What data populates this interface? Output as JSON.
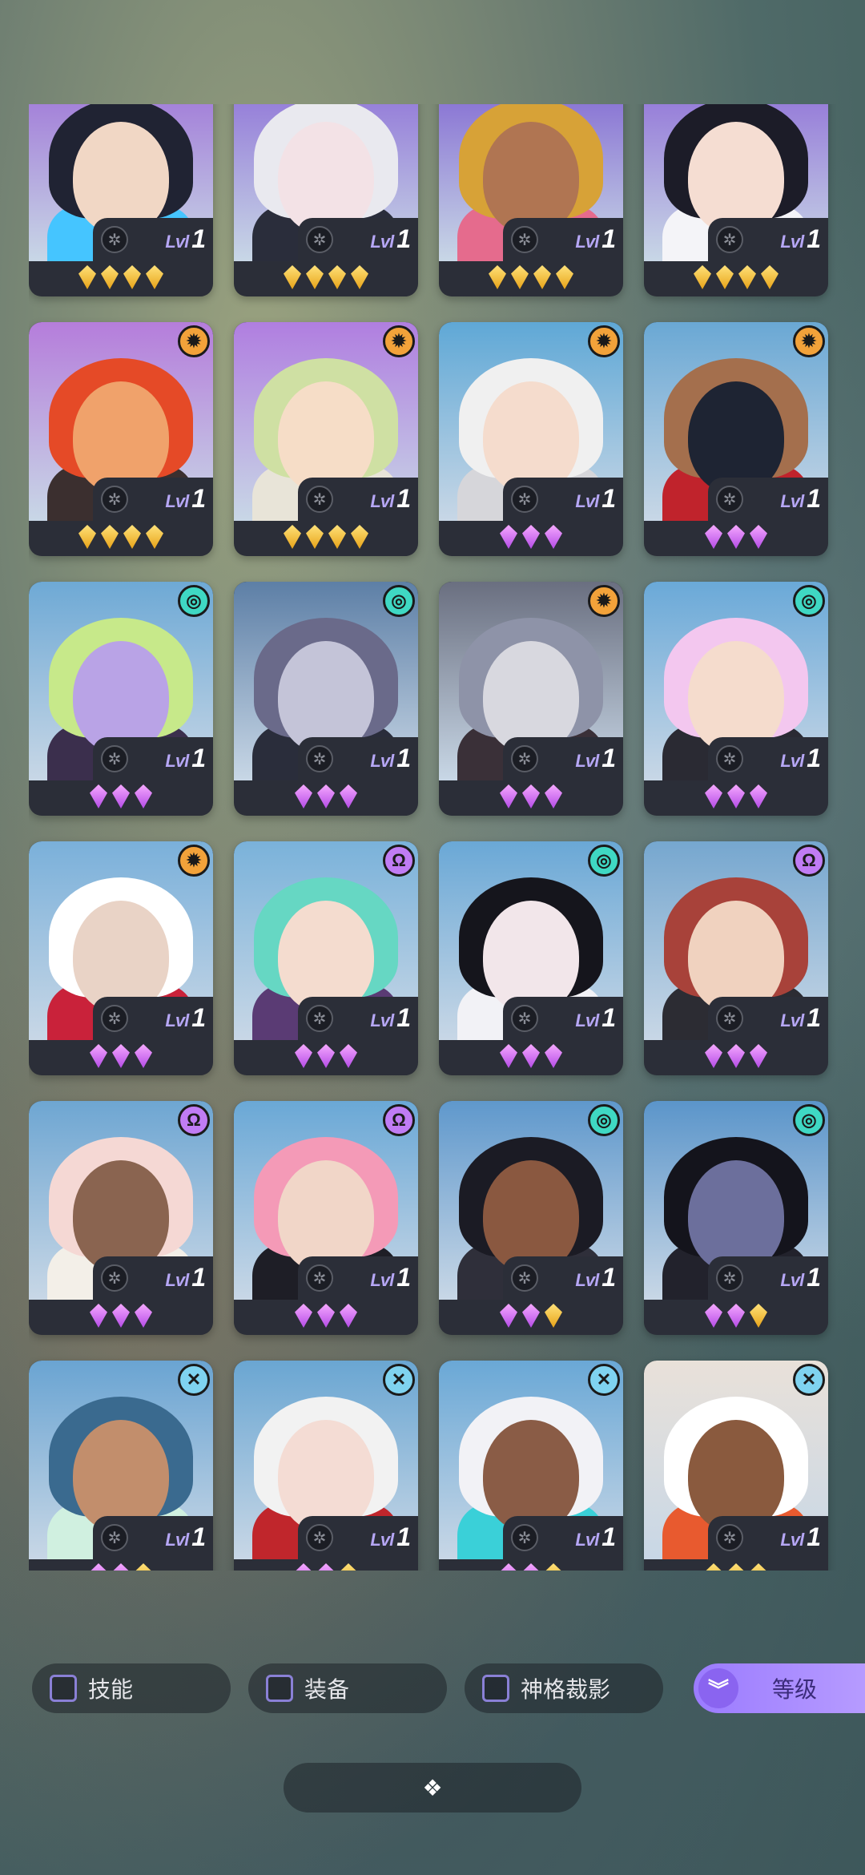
{
  "level_prefix": "Lvl",
  "cards": [
    {
      "level": "1",
      "badge": "none",
      "gems": [
        "gold",
        "gold",
        "gold",
        "gold"
      ],
      "bg": "#9b6cd6",
      "skin": "#f1d7c5",
      "hair": "#202333",
      "body": "#45c5ff"
    },
    {
      "level": "1",
      "badge": "none",
      "gems": [
        "gold",
        "gold",
        "gold",
        "gold"
      ],
      "bg": "#8a6ad6",
      "skin": "#f3e2e6",
      "hair": "#e9e9ef",
      "body": "#2a2d3b"
    },
    {
      "level": "1",
      "badge": "none",
      "gems": [
        "gold",
        "gold",
        "gold",
        "gold"
      ],
      "bg": "#7c5fd0",
      "skin": "#b07552",
      "hair": "#d7a237",
      "body": "#e56b8d"
    },
    {
      "level": "1",
      "badge": "none",
      "gems": [
        "gold",
        "gold",
        "gold",
        "gold"
      ],
      "bg": "#8b68d6",
      "skin": "#f5ddd2",
      "hair": "#1c1c28",
      "body": "#f4f4f8"
    },
    {
      "level": "1",
      "badge": "sun",
      "gems": [
        "gold",
        "gold",
        "gold",
        "gold"
      ],
      "bg": "#b57ddb",
      "skin": "#f0a26b",
      "hair": "#e54a27",
      "body": "#3b2f2f"
    },
    {
      "level": "1",
      "badge": "sun",
      "gems": [
        "gold",
        "gold",
        "gold",
        "gold"
      ],
      "bg": "#b07ee0",
      "skin": "#f6ddc7",
      "hair": "#cfe0a3",
      "body": "#e8e4d8"
    },
    {
      "level": "1",
      "badge": "sun",
      "gems": [
        "purple",
        "purple",
        "purple"
      ],
      "bg": "#5fa8d6",
      "skin": "#f5dccd",
      "hair": "#f0f0f0",
      "body": "#d6d6da"
    },
    {
      "level": "1",
      "badge": "sun",
      "gems": [
        "purple",
        "purple",
        "purple"
      ],
      "bg": "#6aa8d4",
      "skin": "#1e2433",
      "hair": "#a46f4d",
      "body": "#c0232c"
    },
    {
      "level": "1",
      "badge": "wave",
      "gems": [
        "purple",
        "purple",
        "purple"
      ],
      "bg": "#6ea9d5",
      "skin": "#b9a3e6",
      "hair": "#c7e98a",
      "body": "#3b2f4d"
    },
    {
      "level": "1",
      "badge": "wave",
      "gems": [
        "purple",
        "purple",
        "purple"
      ],
      "bg": "#5d7fa6",
      "skin": "#c4c4d8",
      "hair": "#6a6a8a",
      "body": "#2a2d3b"
    },
    {
      "level": "1",
      "badge": "sun",
      "gems": [
        "purple",
        "purple",
        "purple"
      ],
      "bg": "#6a6f80",
      "skin": "#d8d8df",
      "hair": "#8e93a8",
      "body": "#3a3038"
    },
    {
      "level": "1",
      "badge": "wave",
      "gems": [
        "purple",
        "purple",
        "purple"
      ],
      "bg": "#6aa9d8",
      "skin": "#f5dccd",
      "hair": "#f3c7ef",
      "body": "#2a2a33"
    },
    {
      "level": "1",
      "badge": "sun",
      "gems": [
        "purple",
        "purple",
        "purple"
      ],
      "bg": "#7ab0da",
      "skin": "#e9d3c6",
      "hair": "#ffffff",
      "body": "#c9223a"
    },
    {
      "level": "1",
      "badge": "omega",
      "gems": [
        "purple",
        "purple",
        "purple"
      ],
      "bg": "#7ab2da",
      "skin": "#f4dccf",
      "hair": "#66d7c3",
      "body": "#5a3b74"
    },
    {
      "level": "1",
      "badge": "wave",
      "gems": [
        "purple",
        "purple",
        "purple"
      ],
      "bg": "#6aa8d6",
      "skin": "#f2e6ea",
      "hair": "#15151c",
      "body": "#f2f2f6"
    },
    {
      "level": "1",
      "badge": "omega",
      "gems": [
        "purple",
        "purple",
        "purple"
      ],
      "bg": "#76a7cf",
      "skin": "#f0d2bf",
      "hair": "#a8423a",
      "body": "#2c2c33"
    },
    {
      "level": "1",
      "badge": "omega",
      "gems": [
        "purple",
        "purple",
        "purple"
      ],
      "bg": "#6ea6d2",
      "skin": "#8a6450",
      "hair": "#f5d8d4",
      "body": "#f3efe8"
    },
    {
      "level": "1",
      "badge": "omega",
      "gems": [
        "purple",
        "purple",
        "purple"
      ],
      "bg": "#6aa8d6",
      "skin": "#f1d6c8",
      "hair": "#f49ab7",
      "body": "#1e1e26"
    },
    {
      "level": "1",
      "badge": "wave",
      "gems": [
        "purple",
        "purple",
        "gold"
      ],
      "bg": "#5f98cc",
      "skin": "#8a5840",
      "hair": "#1b1b24",
      "body": "#2f2f3a"
    },
    {
      "level": "1",
      "badge": "wave",
      "gems": [
        "purple",
        "purple",
        "gold"
      ],
      "bg": "#5b95ca",
      "skin": "#6c6f9c",
      "hair": "#14141c",
      "body": "#22222c"
    },
    {
      "level": "1",
      "badge": "cross",
      "gems": [
        "purple",
        "purple",
        "gold"
      ],
      "bg": "#6aa4d2",
      "skin": "#c28e6c",
      "hair": "#3a6a8f",
      "body": "#d0f0e0"
    },
    {
      "level": "1",
      "badge": "cross",
      "gems": [
        "purple",
        "purple",
        "gold"
      ],
      "bg": "#6aa6d2",
      "skin": "#f4dcd4",
      "hair": "#f2f2f2",
      "body": "#c0262c"
    },
    {
      "level": "1",
      "badge": "cross",
      "gems": [
        "purple",
        "purple",
        "gold"
      ],
      "bg": "#6aa8d6",
      "skin": "#8a5c46",
      "hair": "#f2f2f6",
      "body": "#3ad0d8"
    },
    {
      "level": "1",
      "badge": "cross",
      "gems": [
        "gold",
        "gold",
        "gold"
      ],
      "bg": "#e9e1d9",
      "skin": "#8a5a3e",
      "hair": "#ffffff",
      "body": "#e85a2f"
    }
  ],
  "filters": {
    "skill_label": "技能",
    "equipment_label": "装备",
    "divine_label": "神格裁影",
    "sort_label": "等级"
  },
  "colors": {
    "card_bg": "#2b2e38",
    "accent_purple": "#9b7bff",
    "gem_gold": "#e7a318",
    "gem_purple": "#b44be6"
  }
}
